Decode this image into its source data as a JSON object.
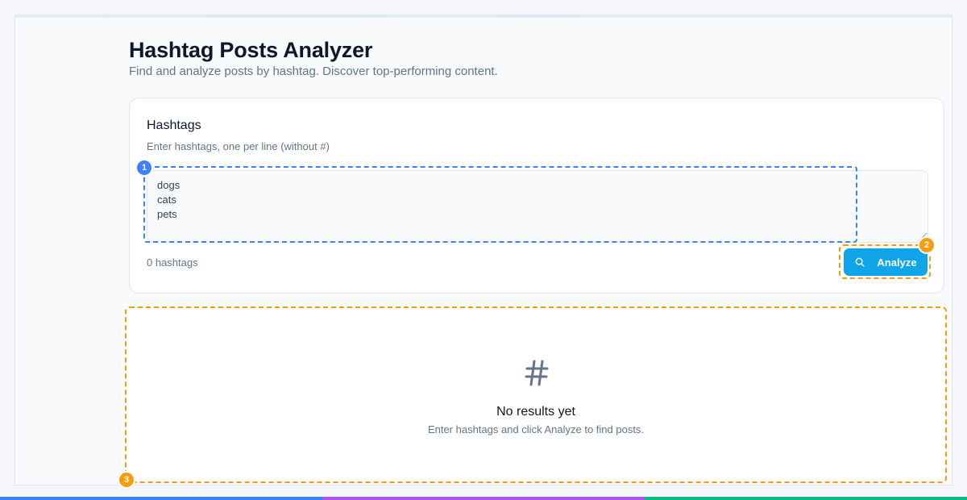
{
  "page": {
    "title": "Hashtag Posts Analyzer",
    "subtitle": "Find and analyze posts by hashtag. Discover top-performing content."
  },
  "input_card": {
    "title": "Hashtags",
    "hint": "Enter hashtags, one per line (without #)",
    "textarea_value": "dogs\ncats\npets",
    "count_label": "0 hashtags",
    "analyze_label": "Analyze"
  },
  "results": {
    "icon": "hashtag-icon",
    "empty_title": "No results yet",
    "empty_subtitle": "Enter hashtags and click Analyze to find posts."
  },
  "markers": [
    "1",
    "2",
    "3"
  ],
  "colors": {
    "accent": "#0ea5e9",
    "marker_blue": "#3b82f6",
    "marker_orange": "#f59e0b",
    "bottom_bar": [
      "#3b82f6",
      "#a855f7",
      "#10b981"
    ]
  }
}
